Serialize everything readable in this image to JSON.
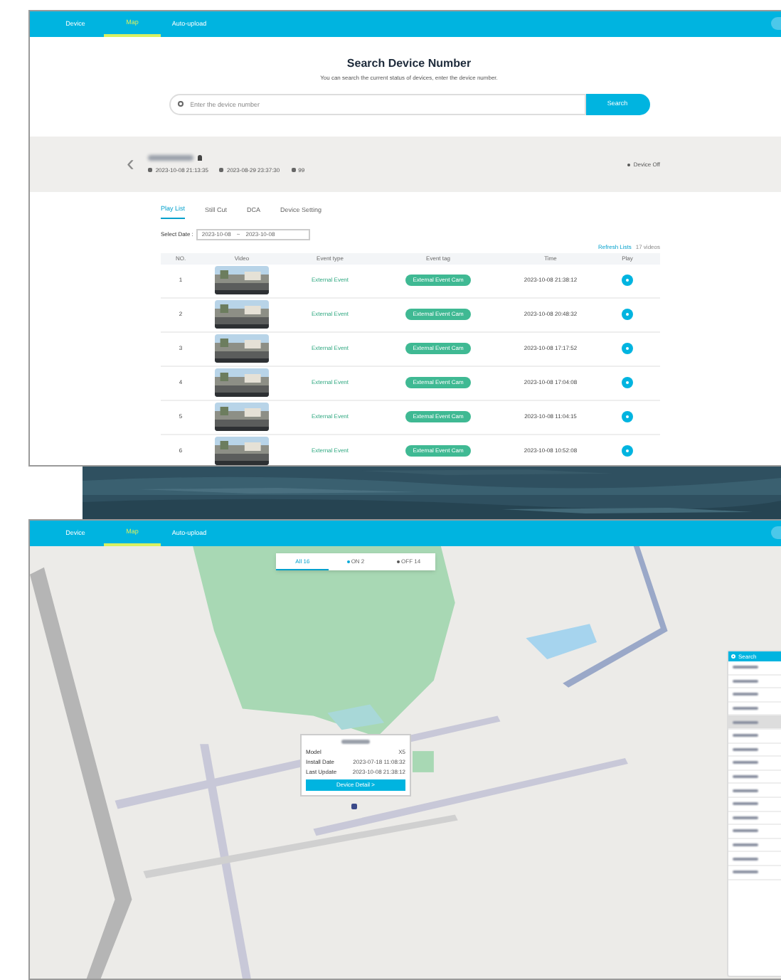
{
  "top_screen": {
    "nav": [
      {
        "label": "Device",
        "selected": false
      },
      {
        "label": "Map",
        "selected": true
      },
      {
        "label": "Auto-upload",
        "selected": false
      }
    ],
    "search": {
      "title": "Search Device Number",
      "subtitle": "You can search the current status of devices, enter the device number.",
      "placeholder": "Enter the device number",
      "button": "Search"
    },
    "device": {
      "back": "‹",
      "info": [
        "2023-10-08 21:13:35",
        "2023-08-29 23:37:30",
        "99"
      ],
      "status": "Device Off"
    },
    "tabs": [
      {
        "label": "Play List",
        "selected": true
      },
      {
        "label": "Still Cut",
        "selected": false
      },
      {
        "label": "DCA",
        "selected": false
      },
      {
        "label": "Device Setting",
        "selected": false
      }
    ],
    "date_filter": {
      "label": "Select Date :",
      "from": "2023-10-08",
      "separator": "~",
      "to": "2023-10-08"
    },
    "refresh": "Refresh Lists",
    "count": "17 videos",
    "table": {
      "columns": [
        "NO.",
        "Video",
        "Event type",
        "Event tag",
        "Time",
        "Play"
      ],
      "rows": [
        {
          "no": "1",
          "event_type": "External Event",
          "event_tag": "External Event Cam",
          "time": "2023-10-08 21:38:12"
        },
        {
          "no": "2",
          "event_type": "External Event",
          "event_tag": "External Event Cam",
          "time": "2023-10-08 20:48:32"
        },
        {
          "no": "3",
          "event_type": "External Event",
          "event_tag": "External Event Cam",
          "time": "2023-10-08 17:17:52"
        },
        {
          "no": "4",
          "event_type": "External Event",
          "event_tag": "External Event Cam",
          "time": "2023-10-08 17:04:08"
        },
        {
          "no": "5",
          "event_type": "External Event",
          "event_tag": "External Event Cam",
          "time": "2023-10-08 11:04:15"
        },
        {
          "no": "6",
          "event_type": "External Event",
          "event_tag": "External Event Cam",
          "time": "2023-10-08 10:52:08"
        }
      ]
    }
  },
  "map_screen": {
    "nav": [
      {
        "label": "Device",
        "selected": false
      },
      {
        "label": "Map",
        "selected": true
      },
      {
        "label": "Auto-upload",
        "selected": false
      }
    ],
    "filters": [
      {
        "label": "All 16",
        "selected": true
      },
      {
        "label": "ON 2",
        "selected": false,
        "color": "#00a8d8"
      },
      {
        "label": "OFF 14",
        "selected": false,
        "color": "#555555"
      }
    ],
    "popup": {
      "rows": [
        {
          "label": "Model",
          "value": "X5"
        },
        {
          "label": "Install Date",
          "value": "2023-07-18 11:08:32"
        },
        {
          "label": "Last Update",
          "value": "2023-10-08 21:38:12"
        }
      ],
      "button": "Device Detail >"
    },
    "device_list": {
      "placeholder": "Search"
    }
  }
}
